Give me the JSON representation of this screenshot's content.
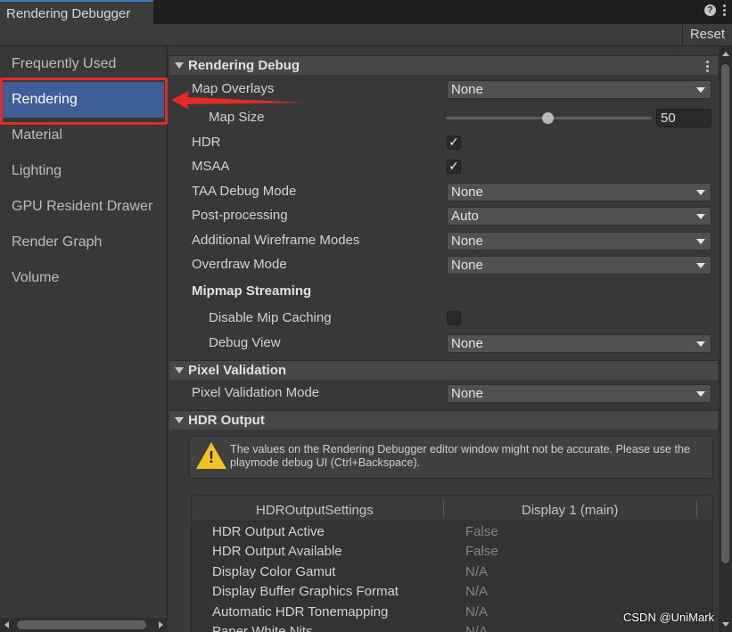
{
  "window": {
    "tab_title": "Rendering Debugger",
    "reset_label": "Reset",
    "help_icon": "question-icon",
    "menu_icon": "kebab-menu-icon"
  },
  "sidebar": {
    "items": [
      {
        "label": "Frequently Used",
        "selected": false
      },
      {
        "label": "Rendering",
        "selected": true
      },
      {
        "label": "Material",
        "selected": false
      },
      {
        "label": "Lighting",
        "selected": false
      },
      {
        "label": "GPU Resident Drawer",
        "selected": false
      },
      {
        "label": "Render Graph",
        "selected": false
      },
      {
        "label": "Volume",
        "selected": false
      }
    ]
  },
  "sections": {
    "rendering_debug": {
      "title": "Rendering Debug",
      "map_overlays": {
        "label": "Map Overlays",
        "value": "None"
      },
      "map_size": {
        "label": "Map Size",
        "value": "50",
        "slider_fraction": 0.5
      },
      "hdr": {
        "label": "HDR",
        "checked": true
      },
      "msaa": {
        "label": "MSAA",
        "checked": true
      },
      "taa_debug_mode": {
        "label": "TAA Debug Mode",
        "value": "None"
      },
      "post_processing": {
        "label": "Post-processing",
        "value": "Auto"
      },
      "wireframe": {
        "label": "Additional Wireframe Modes",
        "value": "None"
      },
      "overdraw": {
        "label": "Overdraw Mode",
        "value": "None"
      },
      "mipmap": {
        "title": "Mipmap Streaming",
        "disable_caching": {
          "label": "Disable Mip Caching",
          "checked": false
        },
        "debug_view": {
          "label": "Debug View",
          "value": "None"
        }
      }
    },
    "pixel_validation": {
      "title": "Pixel Validation",
      "mode": {
        "label": "Pixel Validation Mode",
        "value": "None"
      }
    },
    "hdr_output": {
      "title": "HDR Output",
      "warning": "The values on the Rendering Debugger editor window might not be accurate. Please use the playmode debug UI (Ctrl+Backspace).",
      "table": {
        "headers": [
          "HDROutputSettings",
          "Display 1 (main)"
        ],
        "rows": [
          {
            "label": "HDR Output Active",
            "value": "False"
          },
          {
            "label": "HDR Output Available",
            "value": "False"
          },
          {
            "label": "Display Color Gamut",
            "value": "N/A"
          },
          {
            "label": "Display Buffer Graphics Format",
            "value": "N/A"
          },
          {
            "label": "Automatic HDR Tonemapping",
            "value": "N/A"
          },
          {
            "label": "Paper White Nits",
            "value": "N/A"
          }
        ]
      }
    }
  },
  "watermark": "CSDN @UniMark",
  "colors": {
    "selection": "#3e5f96",
    "annotation_red": "#e32a26",
    "warning_yellow": "#f2c31f"
  }
}
